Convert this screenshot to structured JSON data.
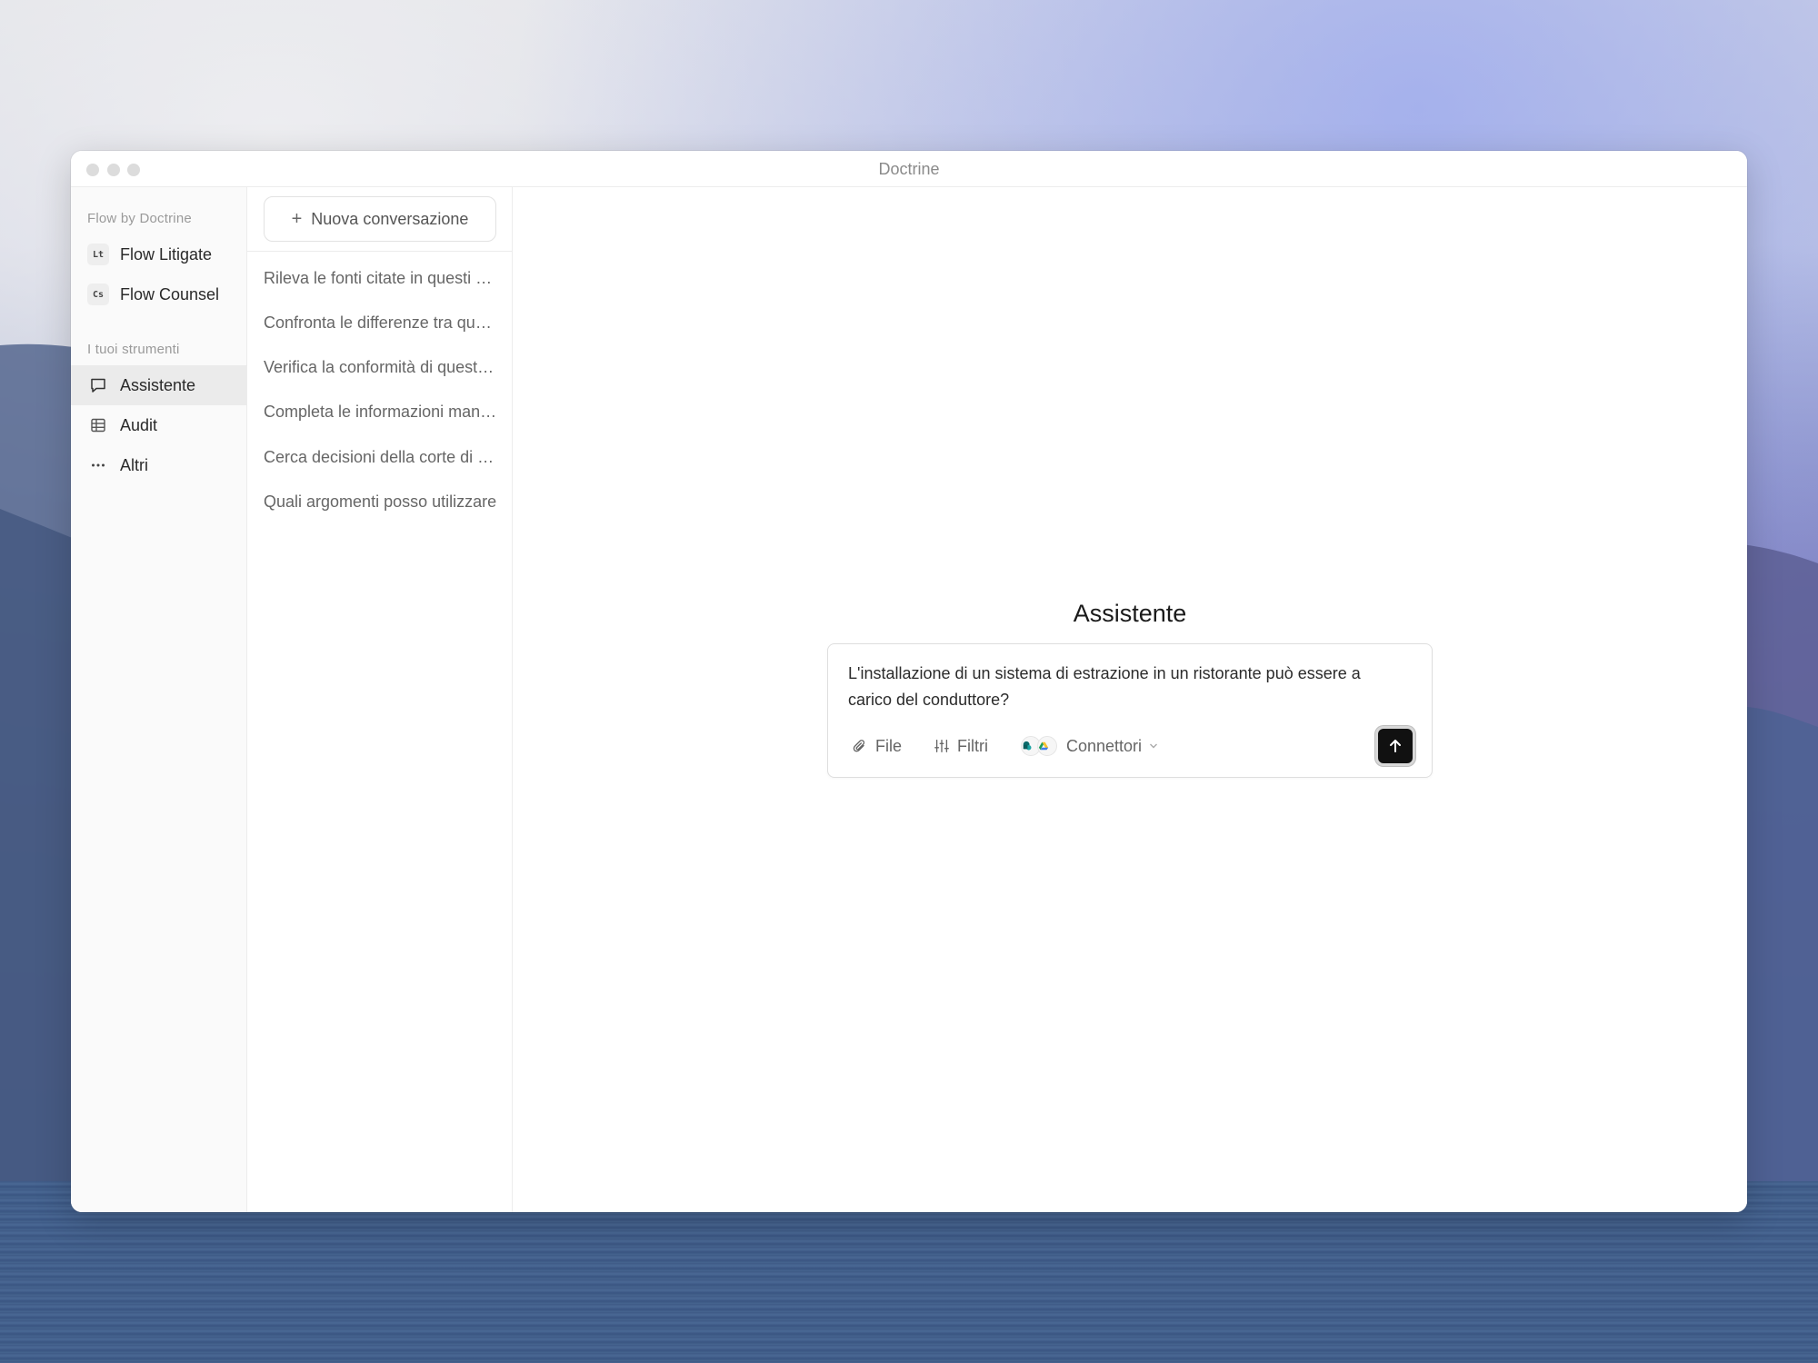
{
  "window": {
    "title": "Doctrine"
  },
  "sidebar": {
    "section1_label": "Flow by Doctrine",
    "products": [
      {
        "badge": "Lt",
        "label": "Flow Litigate"
      },
      {
        "badge": "Cs",
        "label": "Flow Counsel"
      }
    ],
    "section2_label": "I tuoi strumenti",
    "tools": [
      {
        "icon": "chat-bubble-icon",
        "label": "Assistente",
        "active": true
      },
      {
        "icon": "table-icon",
        "label": "Audit",
        "active": false
      },
      {
        "icon": "ellipsis-icon",
        "label": "Altri",
        "active": false
      }
    ]
  },
  "conversations": {
    "new_button_label": "Nuova conversazione",
    "items": [
      "Rileva le fonti citate in questi documenti",
      "Confronta le differenze tra queste versioni",
      "Verifica la conformità di questo contratto",
      "Completa le informazioni mancanti",
      "Cerca decisioni della corte di cassazione",
      "Quali argomenti posso utilizzare"
    ]
  },
  "main": {
    "title": "Assistente",
    "composer": {
      "text": "L'installazione di un sistema di estrazione in un ristorante può essere a carico del conduttore?",
      "file_label": "File",
      "filters_label": "Filtri",
      "connectors_label": "Connettori"
    }
  },
  "colors": {
    "send_button": "#111111",
    "active_nav_bg": "#ebebeb"
  }
}
